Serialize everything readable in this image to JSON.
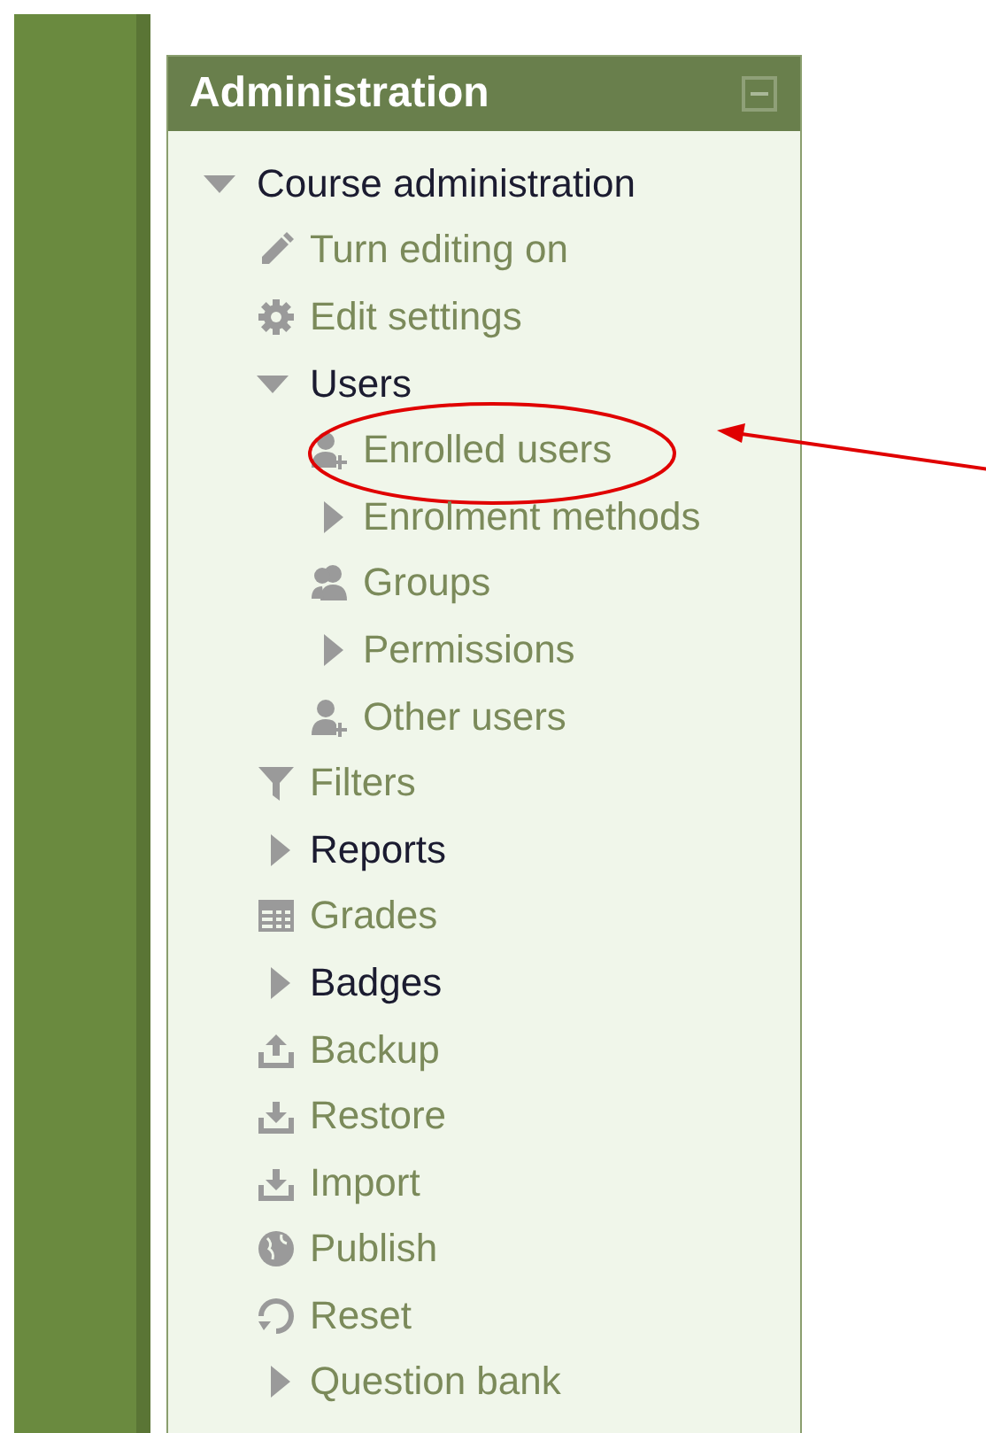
{
  "block": {
    "title": "Administration",
    "collapsed": false
  },
  "tree": [
    {
      "kind": "branch",
      "label": "Course administration",
      "expanded": true,
      "link": false,
      "children": [
        {
          "kind": "link",
          "label": "Turn editing on"
        },
        {
          "kind": "link",
          "label": "Edit settings"
        },
        {
          "kind": "branch",
          "label": "Users",
          "expanded": true,
          "link": false,
          "children": [
            {
              "kind": "link",
              "label": "Enrolled users",
              "highlighted": true
            },
            {
              "kind": "branch",
              "label": "Enrolment methods",
              "expanded": false,
              "link": true
            },
            {
              "kind": "link",
              "label": "Groups"
            },
            {
              "kind": "branch",
              "label": "Permissions",
              "expanded": false,
              "link": true
            },
            {
              "kind": "link",
              "label": "Other users"
            }
          ]
        },
        {
          "kind": "link",
          "label": "Filters"
        },
        {
          "kind": "branch",
          "label": "Reports",
          "expanded": false,
          "link": false
        },
        {
          "kind": "link",
          "label": "Grades"
        },
        {
          "kind": "branch",
          "label": "Badges",
          "expanded": false,
          "link": false
        },
        {
          "kind": "link",
          "label": "Backup"
        },
        {
          "kind": "link",
          "label": "Restore"
        },
        {
          "kind": "link",
          "label": "Import"
        },
        {
          "kind": "link",
          "label": "Publish"
        },
        {
          "kind": "link",
          "label": "Reset"
        },
        {
          "kind": "branch",
          "label": "Question bank",
          "expanded": false,
          "link": true
        }
      ]
    }
  ]
}
